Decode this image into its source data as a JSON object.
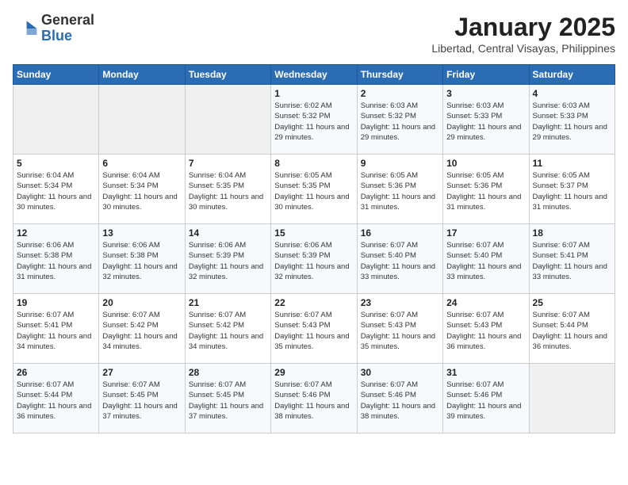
{
  "header": {
    "logo_general": "General",
    "logo_blue": "Blue",
    "title": "January 2025",
    "subtitle": "Libertad, Central Visayas, Philippines"
  },
  "weekdays": [
    "Sunday",
    "Monday",
    "Tuesday",
    "Wednesday",
    "Thursday",
    "Friday",
    "Saturday"
  ],
  "weeks": [
    [
      {
        "day": "",
        "sunrise": "",
        "sunset": "",
        "daylight": ""
      },
      {
        "day": "",
        "sunrise": "",
        "sunset": "",
        "daylight": ""
      },
      {
        "day": "",
        "sunrise": "",
        "sunset": "",
        "daylight": ""
      },
      {
        "day": "1",
        "sunrise": "Sunrise: 6:02 AM",
        "sunset": "Sunset: 5:32 PM",
        "daylight": "Daylight: 11 hours and 29 minutes."
      },
      {
        "day": "2",
        "sunrise": "Sunrise: 6:03 AM",
        "sunset": "Sunset: 5:32 PM",
        "daylight": "Daylight: 11 hours and 29 minutes."
      },
      {
        "day": "3",
        "sunrise": "Sunrise: 6:03 AM",
        "sunset": "Sunset: 5:33 PM",
        "daylight": "Daylight: 11 hours and 29 minutes."
      },
      {
        "day": "4",
        "sunrise": "Sunrise: 6:03 AM",
        "sunset": "Sunset: 5:33 PM",
        "daylight": "Daylight: 11 hours and 29 minutes."
      }
    ],
    [
      {
        "day": "5",
        "sunrise": "Sunrise: 6:04 AM",
        "sunset": "Sunset: 5:34 PM",
        "daylight": "Daylight: 11 hours and 30 minutes."
      },
      {
        "day": "6",
        "sunrise": "Sunrise: 6:04 AM",
        "sunset": "Sunset: 5:34 PM",
        "daylight": "Daylight: 11 hours and 30 minutes."
      },
      {
        "day": "7",
        "sunrise": "Sunrise: 6:04 AM",
        "sunset": "Sunset: 5:35 PM",
        "daylight": "Daylight: 11 hours and 30 minutes."
      },
      {
        "day": "8",
        "sunrise": "Sunrise: 6:05 AM",
        "sunset": "Sunset: 5:35 PM",
        "daylight": "Daylight: 11 hours and 30 minutes."
      },
      {
        "day": "9",
        "sunrise": "Sunrise: 6:05 AM",
        "sunset": "Sunset: 5:36 PM",
        "daylight": "Daylight: 11 hours and 31 minutes."
      },
      {
        "day": "10",
        "sunrise": "Sunrise: 6:05 AM",
        "sunset": "Sunset: 5:36 PM",
        "daylight": "Daylight: 11 hours and 31 minutes."
      },
      {
        "day": "11",
        "sunrise": "Sunrise: 6:05 AM",
        "sunset": "Sunset: 5:37 PM",
        "daylight": "Daylight: 11 hours and 31 minutes."
      }
    ],
    [
      {
        "day": "12",
        "sunrise": "Sunrise: 6:06 AM",
        "sunset": "Sunset: 5:38 PM",
        "daylight": "Daylight: 11 hours and 31 minutes."
      },
      {
        "day": "13",
        "sunrise": "Sunrise: 6:06 AM",
        "sunset": "Sunset: 5:38 PM",
        "daylight": "Daylight: 11 hours and 32 minutes."
      },
      {
        "day": "14",
        "sunrise": "Sunrise: 6:06 AM",
        "sunset": "Sunset: 5:39 PM",
        "daylight": "Daylight: 11 hours and 32 minutes."
      },
      {
        "day": "15",
        "sunrise": "Sunrise: 6:06 AM",
        "sunset": "Sunset: 5:39 PM",
        "daylight": "Daylight: 11 hours and 32 minutes."
      },
      {
        "day": "16",
        "sunrise": "Sunrise: 6:07 AM",
        "sunset": "Sunset: 5:40 PM",
        "daylight": "Daylight: 11 hours and 33 minutes."
      },
      {
        "day": "17",
        "sunrise": "Sunrise: 6:07 AM",
        "sunset": "Sunset: 5:40 PM",
        "daylight": "Daylight: 11 hours and 33 minutes."
      },
      {
        "day": "18",
        "sunrise": "Sunrise: 6:07 AM",
        "sunset": "Sunset: 5:41 PM",
        "daylight": "Daylight: 11 hours and 33 minutes."
      }
    ],
    [
      {
        "day": "19",
        "sunrise": "Sunrise: 6:07 AM",
        "sunset": "Sunset: 5:41 PM",
        "daylight": "Daylight: 11 hours and 34 minutes."
      },
      {
        "day": "20",
        "sunrise": "Sunrise: 6:07 AM",
        "sunset": "Sunset: 5:42 PM",
        "daylight": "Daylight: 11 hours and 34 minutes."
      },
      {
        "day": "21",
        "sunrise": "Sunrise: 6:07 AM",
        "sunset": "Sunset: 5:42 PM",
        "daylight": "Daylight: 11 hours and 34 minutes."
      },
      {
        "day": "22",
        "sunrise": "Sunrise: 6:07 AM",
        "sunset": "Sunset: 5:43 PM",
        "daylight": "Daylight: 11 hours and 35 minutes."
      },
      {
        "day": "23",
        "sunrise": "Sunrise: 6:07 AM",
        "sunset": "Sunset: 5:43 PM",
        "daylight": "Daylight: 11 hours and 35 minutes."
      },
      {
        "day": "24",
        "sunrise": "Sunrise: 6:07 AM",
        "sunset": "Sunset: 5:43 PM",
        "daylight": "Daylight: 11 hours and 36 minutes."
      },
      {
        "day": "25",
        "sunrise": "Sunrise: 6:07 AM",
        "sunset": "Sunset: 5:44 PM",
        "daylight": "Daylight: 11 hours and 36 minutes."
      }
    ],
    [
      {
        "day": "26",
        "sunrise": "Sunrise: 6:07 AM",
        "sunset": "Sunset: 5:44 PM",
        "daylight": "Daylight: 11 hours and 36 minutes."
      },
      {
        "day": "27",
        "sunrise": "Sunrise: 6:07 AM",
        "sunset": "Sunset: 5:45 PM",
        "daylight": "Daylight: 11 hours and 37 minutes."
      },
      {
        "day": "28",
        "sunrise": "Sunrise: 6:07 AM",
        "sunset": "Sunset: 5:45 PM",
        "daylight": "Daylight: 11 hours and 37 minutes."
      },
      {
        "day": "29",
        "sunrise": "Sunrise: 6:07 AM",
        "sunset": "Sunset: 5:46 PM",
        "daylight": "Daylight: 11 hours and 38 minutes."
      },
      {
        "day": "30",
        "sunrise": "Sunrise: 6:07 AM",
        "sunset": "Sunset: 5:46 PM",
        "daylight": "Daylight: 11 hours and 38 minutes."
      },
      {
        "day": "31",
        "sunrise": "Sunrise: 6:07 AM",
        "sunset": "Sunset: 5:46 PM",
        "daylight": "Daylight: 11 hours and 39 minutes."
      },
      {
        "day": "",
        "sunrise": "",
        "sunset": "",
        "daylight": ""
      }
    ]
  ]
}
